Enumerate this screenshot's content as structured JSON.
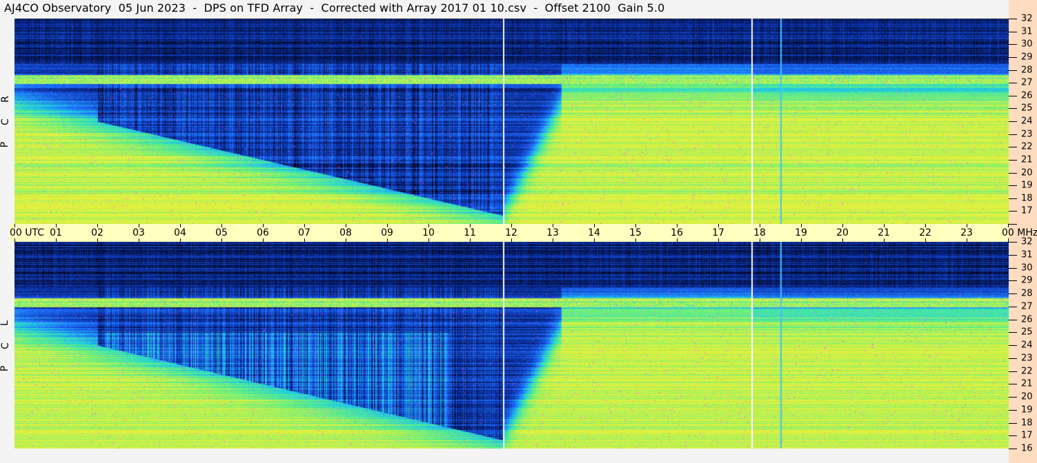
{
  "title": "AJ4CO Observatory  05 Jun 2023  -  DPS on TFD Array  -  Corrected with Array 2017 01 10.csv  -  Offset 2100  Gain 5.0",
  "colors": {
    "axis_strip": "#ffffc0",
    "freq_strip": "#ffdcc0",
    "background": "#000000"
  },
  "chart_data": {
    "type": "heatmap",
    "title": "AJ4CO Observatory 05 Jun 2023 - DPS on TFD Array",
    "xlabel": "UTC",
    "ylabel": "MHz",
    "x_range": [
      0,
      24
    ],
    "y_range": [
      16,
      32
    ],
    "x_ticks": [
      "00 UTC",
      "01",
      "02",
      "03",
      "04",
      "05",
      "06",
      "07",
      "08",
      "09",
      "10",
      "11",
      "12",
      "13",
      "14",
      "15",
      "16",
      "17",
      "18",
      "19",
      "20",
      "21",
      "22",
      "23",
      "00 MHz"
    ],
    "y_ticks": [
      "32",
      "31",
      "30",
      "29",
      "28",
      "27",
      "26",
      "25",
      "24",
      "23",
      "22",
      "21",
      "20",
      "19",
      "18",
      "17",
      "16"
    ],
    "panels": [
      {
        "name": "RCP",
        "letters": [
          "R",
          "C",
          "P"
        ]
      },
      {
        "name": "LCP",
        "letters": [
          "L",
          "C",
          "P"
        ]
      }
    ],
    "vertical_markers_utc": [
      11.8,
      17.8,
      18.5
    ],
    "colormap": [
      "#000000",
      "#0a2a9a",
      "#1e6bff",
      "#20d0e0",
      "#60f080",
      "#e0f040",
      "#ff40ff",
      "#ffffff"
    ]
  }
}
